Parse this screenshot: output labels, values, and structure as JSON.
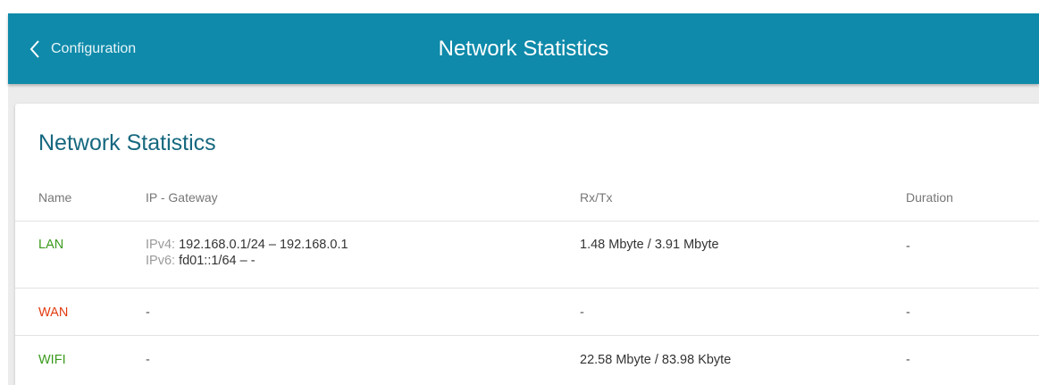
{
  "header": {
    "back_label": "Configuration",
    "title": "Network Statistics"
  },
  "card": {
    "title": "Network Statistics",
    "columns": [
      "Name",
      "IP - Gateway",
      "Rx/Tx",
      "Duration"
    ]
  },
  "rows": [
    {
      "name": "LAN",
      "ipv4_label": "IPv4:",
      "ipv4_value": "192.168.0.1/24 – 192.168.0.1",
      "ipv6_label": "IPv6:",
      "ipv6_value": "fd01::1/64 – -",
      "rxtx": "1.48 Mbyte / 3.91 Mbyte",
      "duration": "-"
    },
    {
      "name": "WAN",
      "ip": "-",
      "rxtx": "-",
      "duration": "-"
    },
    {
      "name": "WIFI",
      "ip": "-",
      "rxtx": "22.58 Mbyte / 83.98 Kbyte",
      "duration": "-"
    }
  ],
  "colors": {
    "topbar": "#0f8aaa",
    "title": "#16687f",
    "status_up": "#3a9a1c",
    "status_down": "#e23b10"
  },
  "icons": {
    "back": "chevron-left-icon"
  }
}
